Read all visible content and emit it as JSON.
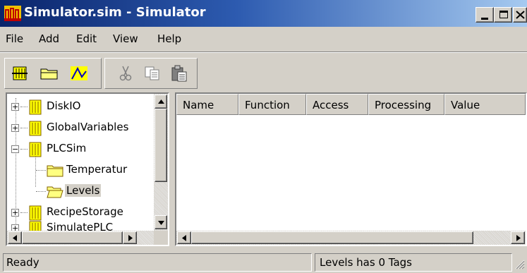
{
  "window": {
    "title": "Simulator.sim - Simulator",
    "controls": {
      "minimize": "_",
      "maximize": "□",
      "close": "×"
    }
  },
  "menu": [
    "File",
    "Add",
    "Edit",
    "View",
    "Help"
  ],
  "toolbar": {
    "buttons": [
      "add-tag-icon",
      "folder-icon",
      "chart-icon",
      "cut-icon",
      "copy-icon",
      "paste-icon"
    ]
  },
  "tree": {
    "items": [
      {
        "label": "DiskIO",
        "expand": "+"
      },
      {
        "label": "GlobalVariables",
        "expand": "+"
      },
      {
        "label": "PLCSim",
        "expand": "−"
      },
      {
        "label": "Temperatur"
      },
      {
        "label": "Levels"
      },
      {
        "label": "RecipeStorage",
        "expand": "+"
      },
      {
        "label": "SimulatePLC",
        "expand": "+"
      }
    ]
  },
  "list": {
    "columns": [
      "Name",
      "Function",
      "Access",
      "Processing",
      "Value"
    ]
  },
  "status": {
    "left": "Ready",
    "right": "Levels has 0 Tags"
  }
}
